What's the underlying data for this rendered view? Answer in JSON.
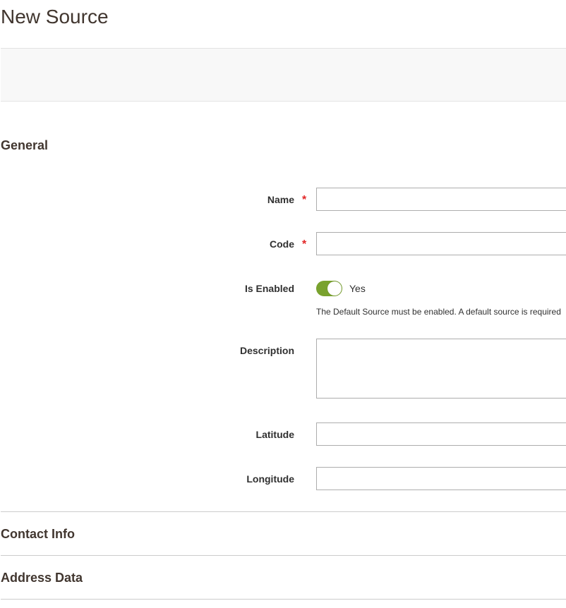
{
  "page": {
    "title": "New Source"
  },
  "sections": {
    "general": "General",
    "contact_info": "Contact Info",
    "address_data": "Address Data"
  },
  "fields": {
    "name": {
      "label": "Name",
      "required": "*",
      "value": ""
    },
    "code": {
      "label": "Code",
      "required": "*",
      "value": ""
    },
    "is_enabled": {
      "label": "Is Enabled",
      "state": "Yes",
      "on": true,
      "note": "The Default Source must be enabled. A default source is required"
    },
    "description": {
      "label": "Description",
      "value": ""
    },
    "latitude": {
      "label": "Latitude",
      "value": ""
    },
    "longitude": {
      "label": "Longitude",
      "value": ""
    }
  },
  "colors": {
    "accent_toggle": "#79a22e",
    "required_star": "#e22626",
    "title_text": "#41362f"
  }
}
